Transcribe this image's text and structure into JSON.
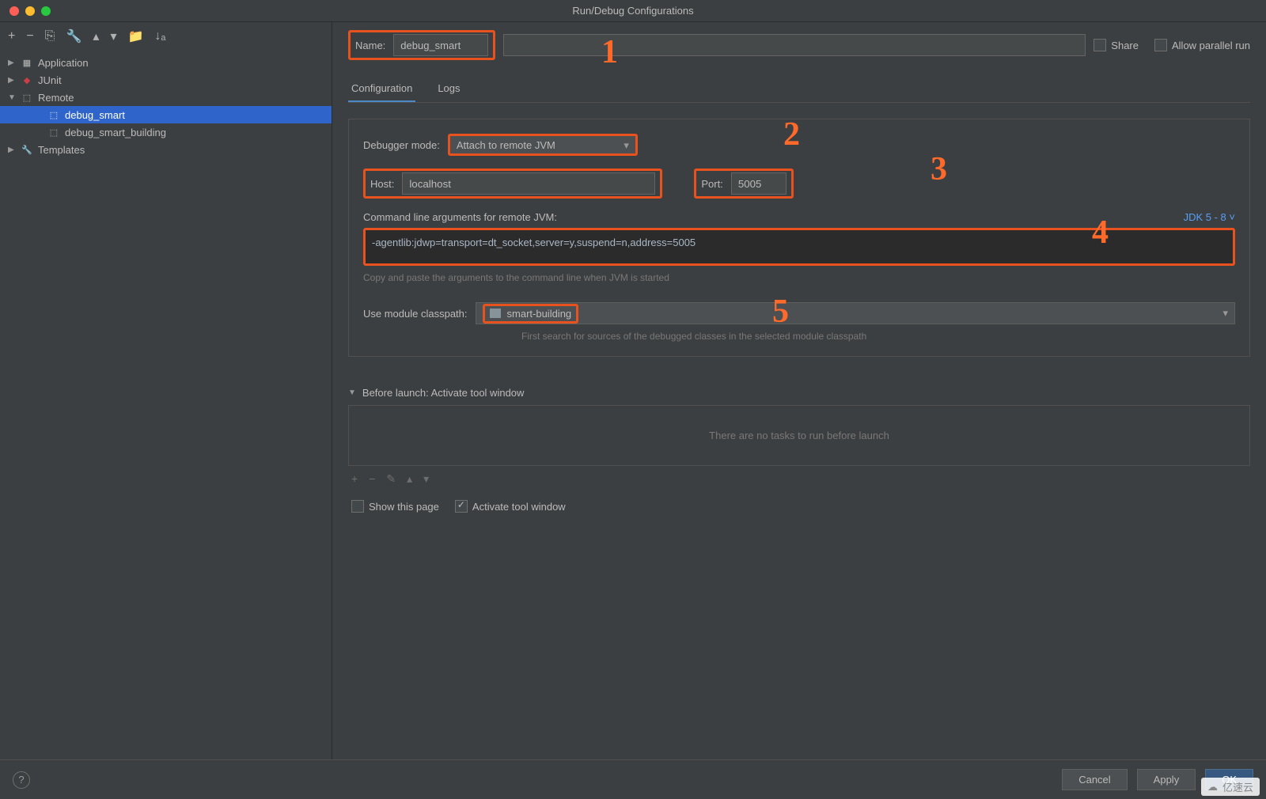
{
  "window": {
    "title": "Run/Debug Configurations"
  },
  "sidebar": {
    "items": [
      {
        "label": "Application",
        "expanded": false
      },
      {
        "label": "JUnit",
        "expanded": false
      },
      {
        "label": "Remote",
        "expanded": true,
        "children": [
          {
            "label": "debug_smart",
            "selected": true
          },
          {
            "label": "debug_smart_building",
            "selected": false
          }
        ]
      },
      {
        "label": "Templates",
        "expanded": false
      }
    ]
  },
  "name": {
    "label": "Name:",
    "value": "debug_smart"
  },
  "options": {
    "share": "Share",
    "parallel": "Allow parallel run"
  },
  "tabs": {
    "configuration": "Configuration",
    "logs": "Logs"
  },
  "fields": {
    "debugger_mode_label": "Debugger mode:",
    "debugger_mode_value": "Attach to remote JVM",
    "host_label": "Host:",
    "host_value": "localhost",
    "port_label": "Port:",
    "port_value": "5005",
    "cmd_label": "Command line arguments for remote JVM:",
    "jdk_label": "JDK 5 - 8",
    "cmd_value": "-agentlib:jdwp=transport=dt_socket,server=y,suspend=n,address=5005",
    "cmd_hint": "Copy and paste the arguments to the command line when JVM is started",
    "module_label": "Use module classpath:",
    "module_value": "smart-building",
    "module_hint": "First search for sources of the debugged classes in the selected module classpath"
  },
  "before_launch": {
    "title": "Before launch: Activate tool window",
    "empty": "There are no tasks to run before launch",
    "show_page": "Show this page",
    "activate": "Activate tool window"
  },
  "buttons": {
    "cancel": "Cancel",
    "apply": "Apply",
    "ok": "OK"
  },
  "annotations": {
    "a1": "1",
    "a2": "2",
    "a3": "3",
    "a4": "4",
    "a5": "5"
  },
  "watermark": "亿速云"
}
